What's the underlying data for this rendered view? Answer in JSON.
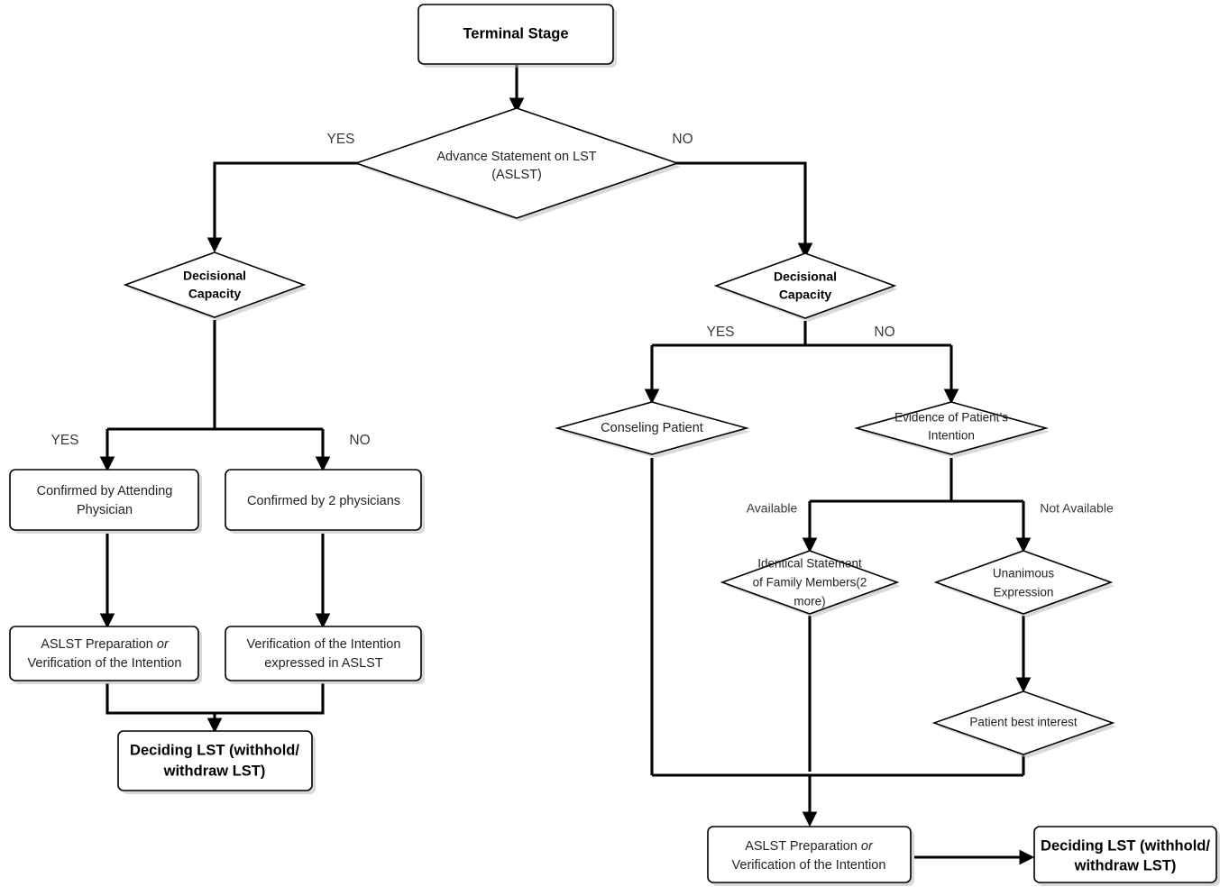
{
  "diagram": {
    "title": "Terminal Stage decision flowchart for Life-Sustaining Treatment (LST)",
    "colors": {
      "stroke": "#000000",
      "fill": "#ffffff",
      "text": "#231f20",
      "label_text": "#3a3a3a",
      "shadow": "#b9b9b9"
    }
  },
  "nodes": {
    "terminal_stage": {
      "label": "Terminal Stage"
    },
    "aslst": {
      "line1": "Advance Statement on LST",
      "line2": "(ASLST)"
    },
    "decisional_capacity_left": {
      "line1": "Decisional",
      "line2": "Capacity"
    },
    "decisional_capacity_right": {
      "line1": "Decisional",
      "line2": "Capacity"
    },
    "confirmed_attending": {
      "line1": "Confirmed by Attending",
      "line2": "Physician"
    },
    "confirmed_two_physicians": {
      "line1": "Confirmed by 2 physicians"
    },
    "aslst_prep_left": {
      "pre": "ASLST Preparation ",
      "em": "or",
      "line2": "Verification of the Intention"
    },
    "verification_aslst": {
      "line1": "Verification of the Intention",
      "line2": "expressed in ASLST"
    },
    "deciding_lst_left": {
      "line1": "Deciding LST (withhold/",
      "line2": "withdraw LST)"
    },
    "conseling_patient": {
      "line1": "Conseling Patient"
    },
    "evidence_intention": {
      "line1": "Evidence of Patient’s",
      "line2": "Intention"
    },
    "identical_statement": {
      "line1": "Identical Statement",
      "line2": "of Family Members(2",
      "line3": "more)"
    },
    "unanimous_expression": {
      "line1": "Unanimous",
      "line2": "Expression"
    },
    "patient_best_interest": {
      "line1": "Patient best interest"
    },
    "aslst_prep_bottom": {
      "pre": "ASLST Preparation ",
      "em": "or",
      "line2": "Verification of the Intention"
    },
    "deciding_lst_right": {
      "line1": "Deciding LST (withhold/",
      "line2": "withdraw LST)"
    }
  },
  "edge_labels": {
    "aslst_yes": "YES",
    "aslst_no": "NO",
    "dc_left_yes": "YES",
    "dc_left_no": "NO",
    "dc_right_yes": "YES",
    "dc_right_no": "NO",
    "evidence_available": "Available",
    "evidence_not_available": "Not Available"
  }
}
